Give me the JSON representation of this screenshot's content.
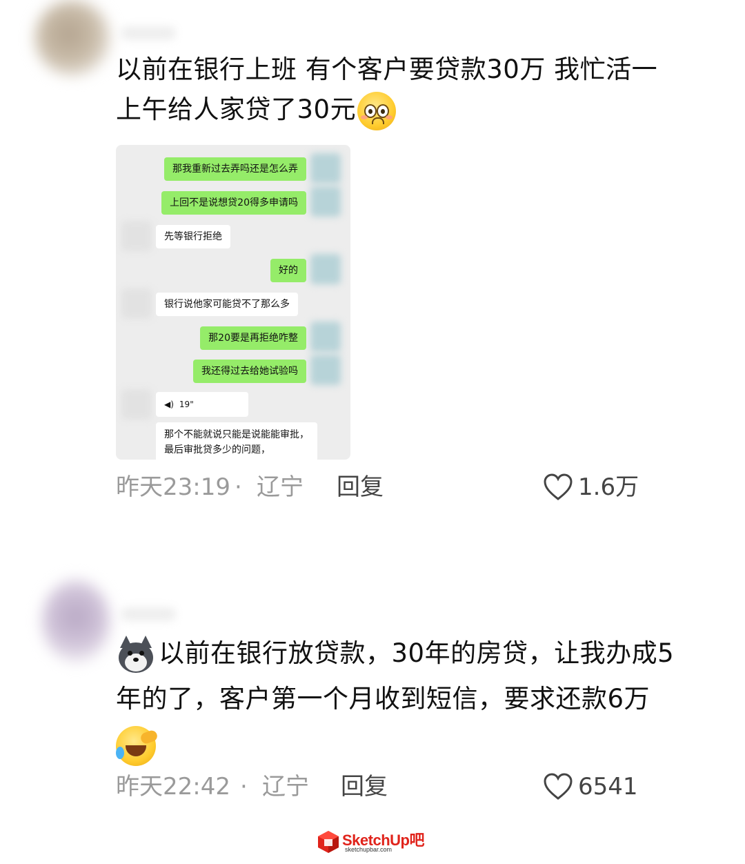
{
  "comments": [
    {
      "text_line1": "以前在银行上班 有个客户要贷款30万 我忙活一",
      "text_line2": "上午给人家贷了30元",
      "emoji": "pleading-face-emoji",
      "time": "昨天23:19",
      "separator": "·",
      "location": "辽宁",
      "reply_label": "回复",
      "likes": "1.6万",
      "screenshot": {
        "messages": [
          {
            "side": "right",
            "text": "那我重新过去弄吗还是怎么弄"
          },
          {
            "side": "right",
            "text": "上回不是说想贷20得多申请吗"
          },
          {
            "side": "left",
            "text": "先等银行拒绝"
          },
          {
            "side": "right",
            "text": "好的"
          },
          {
            "side": "left",
            "text": "银行说他家可能贷不了那么多"
          },
          {
            "side": "right",
            "text": "那20要是再拒绝咋整"
          },
          {
            "side": "right",
            "text": "我还得过去给她试验吗"
          },
          {
            "side": "left",
            "text": "19\""
          },
          {
            "side": "left",
            "text": "那个不能就说只能是说能能审批，最后审批贷多少的问题，"
          }
        ]
      }
    },
    {
      "text_line1": "以前在银行放贷款，30年的房贷，让我办成5",
      "text_line2": "年的了，客户第一个月收到短信，要求还款6万",
      "emoji_leading": "doge-emoji",
      "emoji_trailing": "laughing-crying-emoji",
      "time": "昨天22:42",
      "separator": "·",
      "location": "辽宁",
      "reply_label": "回复",
      "likes": "6541"
    }
  ],
  "watermark": {
    "brand": "SketchUp吧",
    "site": "sketchupbar.com",
    "color": "#e0231b"
  }
}
